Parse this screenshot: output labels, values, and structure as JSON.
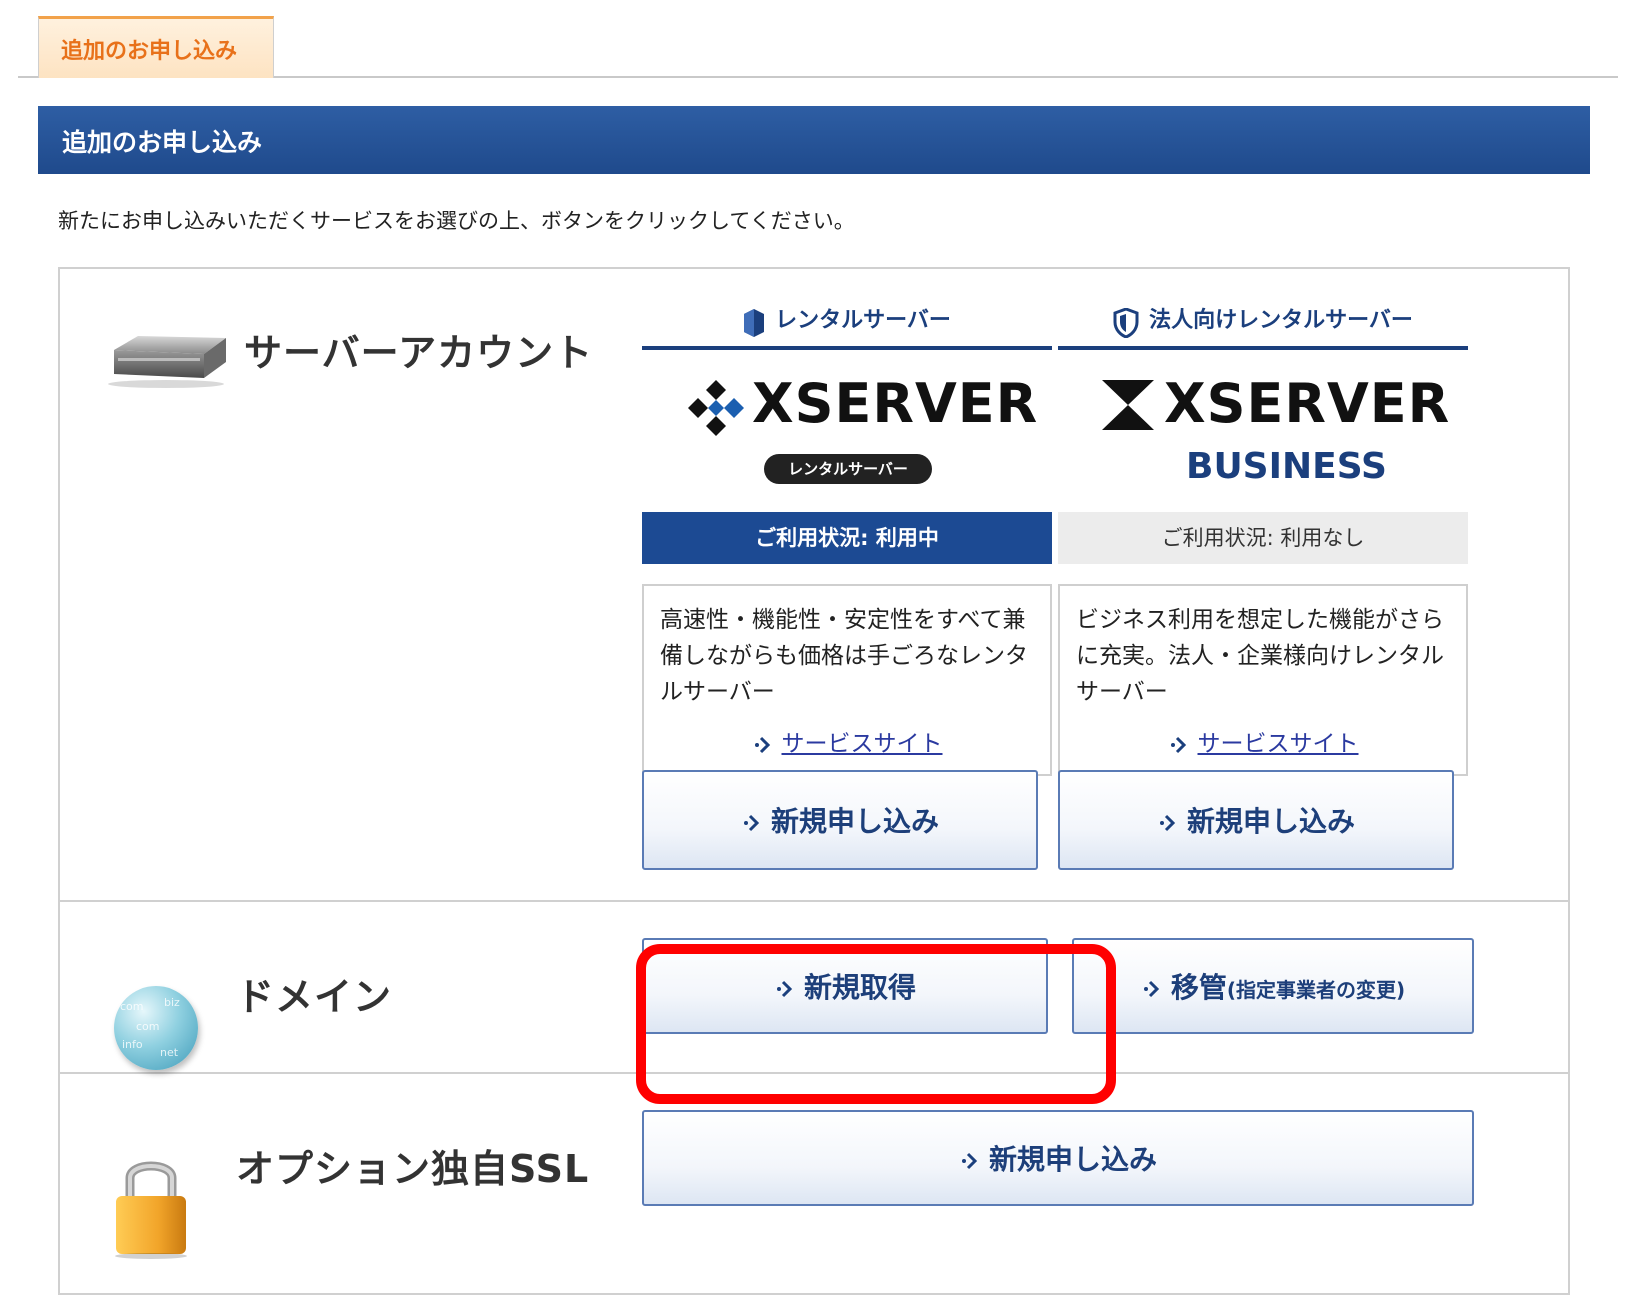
{
  "tab": {
    "label": "追加のお申し込み"
  },
  "section": {
    "title": "追加のお申し込み"
  },
  "intro": "新たにお申し込みいただくサービスをお選びの上、ボタンをクリックしてください。",
  "server_account": {
    "label": "サーバーアカウント",
    "columns": [
      {
        "header": "レンタルサーバー",
        "logo_text": "XSERVER",
        "logo_sub": "レンタルサーバー",
        "status": "ご利用状況: 利用中",
        "description": "高速性・機能性・安定性をすべて兼備しながらも価格は手ごろなレンタルサーバー",
        "link": "サービスサイト",
        "button": "新規申し込み"
      },
      {
        "header": "法人向けレンタルサーバー",
        "logo_text": "XSERVER",
        "logo_sub": "BUSINESS",
        "status": "ご利用状況: 利用なし",
        "description": "ビジネス利用を想定した機能がさらに充実。法人・企業様向けレンタルサーバー",
        "link": "サービスサイト",
        "button": "新規申し込み"
      }
    ]
  },
  "domain": {
    "label": "ドメイン",
    "new_button": "新規取得",
    "transfer_button": "移管",
    "transfer_note": "(指定事業者の変更)",
    "globe_words": [
      "com",
      "biz",
      "com",
      "info",
      "net"
    ]
  },
  "ssl": {
    "label": "オプション独自SSL",
    "button": "新規申し込み"
  },
  "colors": {
    "accent_orange": "#e8711a",
    "header_blue": "#1f4a8c",
    "button_text": "#1d3f7a",
    "highlight": "#ff0000"
  }
}
